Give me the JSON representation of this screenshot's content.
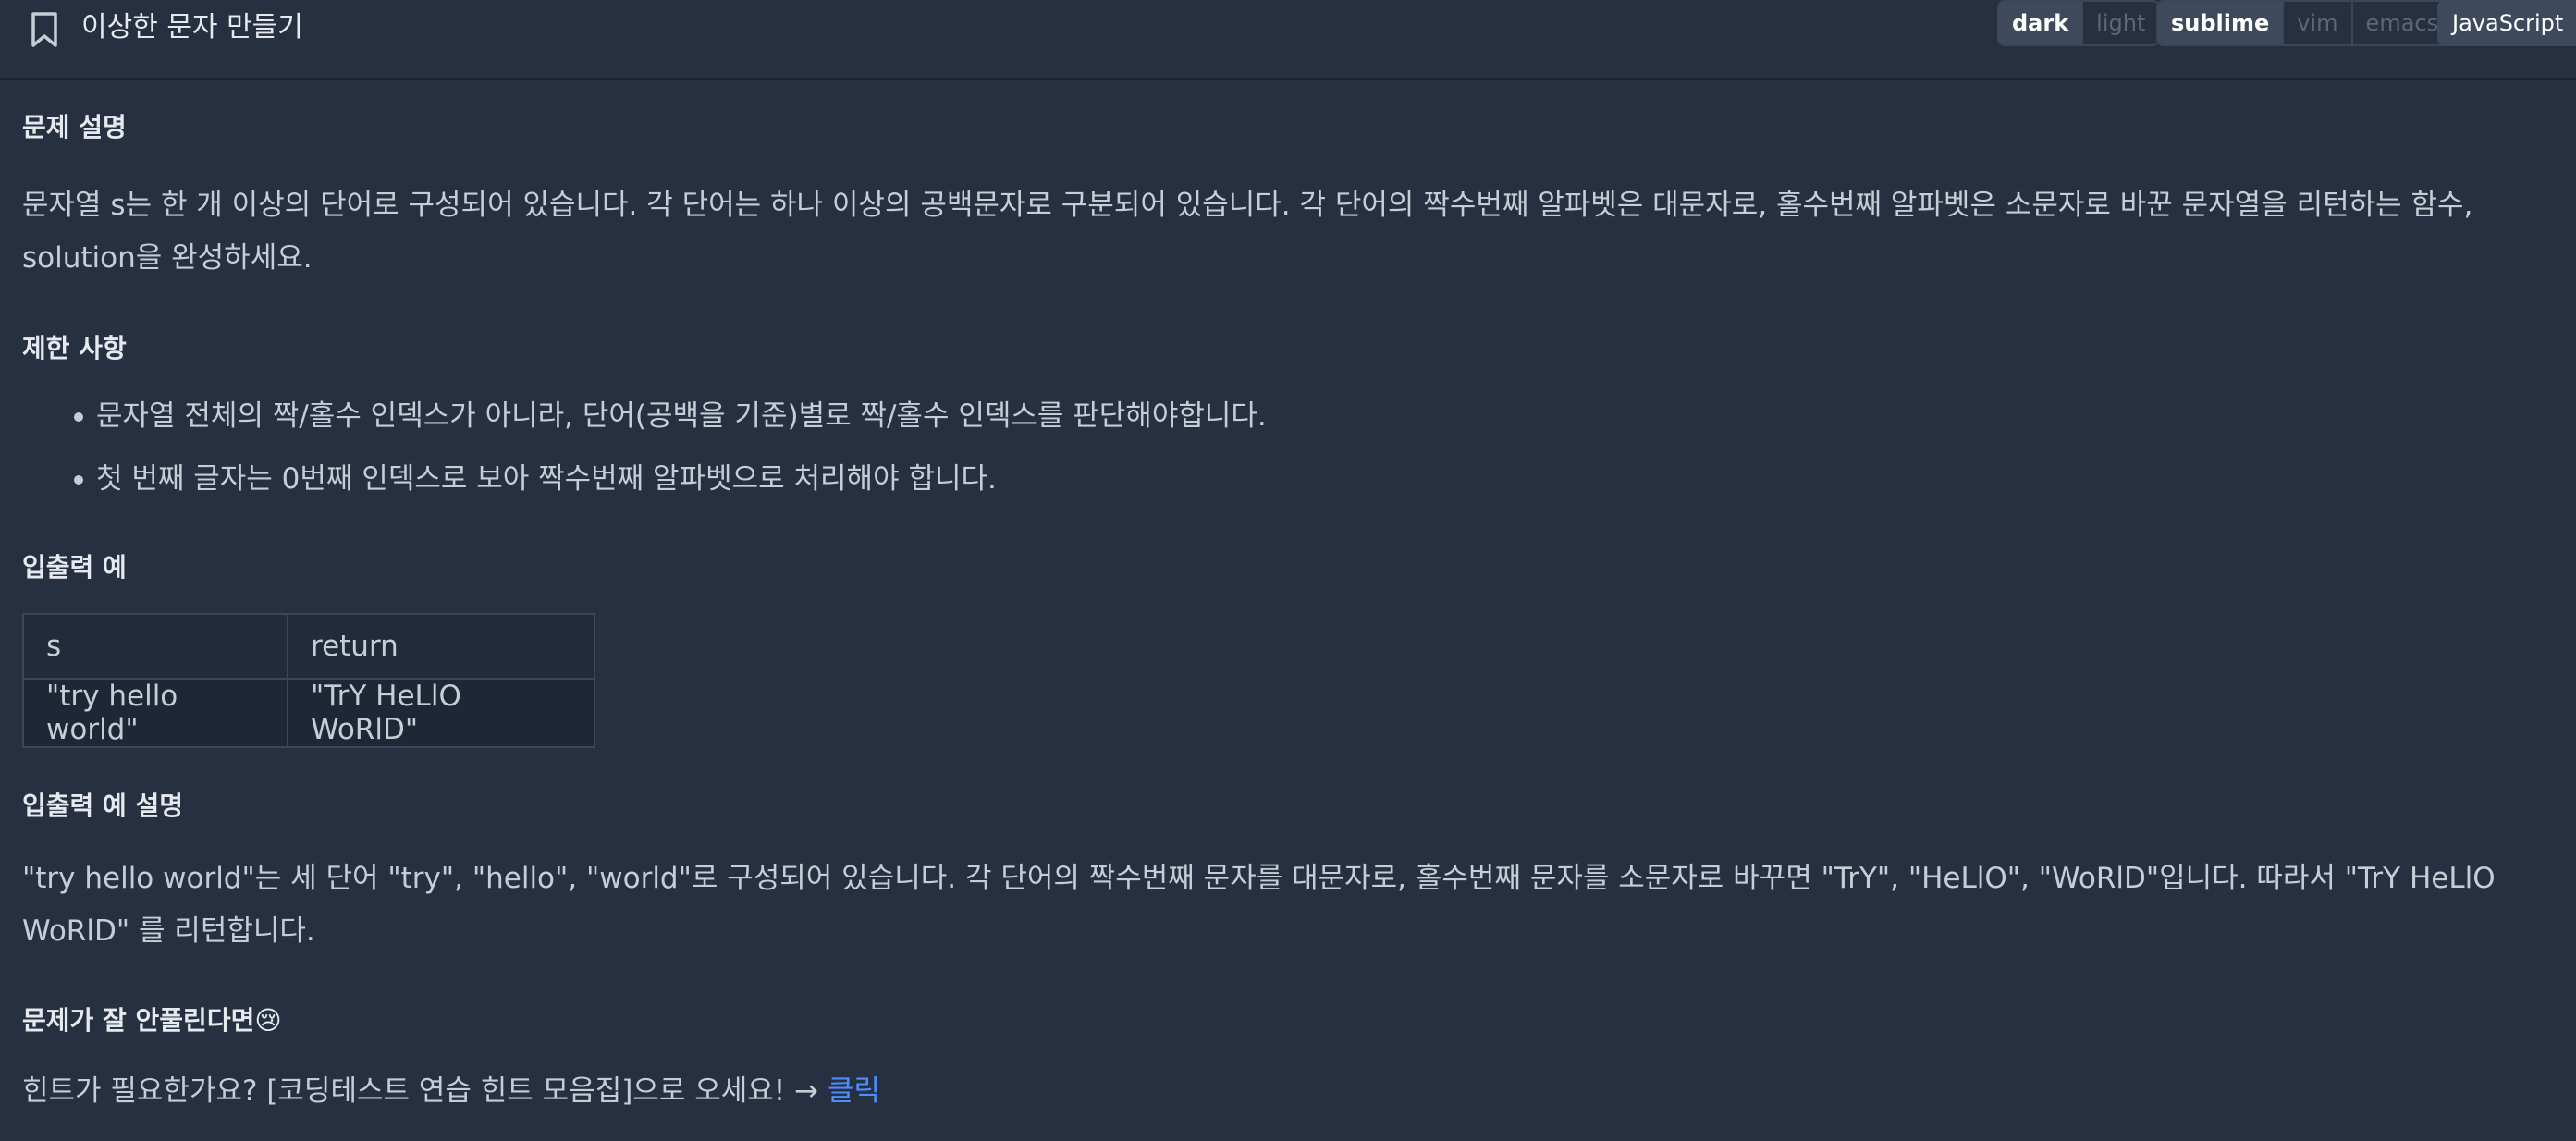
{
  "header": {
    "title": "이상한 문자 만들기",
    "theme_options": [
      {
        "label": "dark",
        "active": true
      },
      {
        "label": "light",
        "active": false
      }
    ],
    "keymap_options": [
      {
        "label": "sublime",
        "active": true
      },
      {
        "label": "vim",
        "active": false
      },
      {
        "label": "emacs",
        "active": false
      }
    ],
    "language": "JavaScript"
  },
  "sections": {
    "description": {
      "heading": "문제 설명",
      "text": "문자열 s는 한 개 이상의 단어로 구성되어 있습니다. 각 단어는 하나 이상의 공백문자로 구분되어 있습니다. 각 단어의 짝수번째 알파벳은 대문자로, 홀수번째 알파벳은 소문자로 바꾼 문자열을 리턴하는 함수, solution을 완성하세요."
    },
    "constraints": {
      "heading": "제한 사항",
      "items": [
        "문자열 전체의 짝/홀수 인덱스가 아니라, 단어(공백을 기준)별로 짝/홀수 인덱스를 판단해야합니다.",
        "첫 번째 글자는 0번째 인덱스로 보아 짝수번째 알파벳으로 처리해야 합니다."
      ]
    },
    "examples": {
      "heading": "입출력 예",
      "columns": [
        "s",
        "return"
      ],
      "rows": [
        [
          "\"try hello world\"",
          "\"TrY HeLlO WoRlD\""
        ]
      ]
    },
    "example_explanation": {
      "heading": "입출력 예 설명",
      "text": "\"try hello world\"는 세 단어 \"try\", \"hello\", \"world\"로 구성되어 있습니다. 각 단어의 짝수번째 문자를 대문자로, 홀수번째 문자를 소문자로 바꾸면 \"TrY\", \"HeLlO\", \"WoRlD\"입니다. 따라서 \"TrY HeLlO WoRlD\" 를 리턴합니다."
    },
    "hint": {
      "heading": "문제가 잘 안풀린다면😢",
      "text": "힌트가 필요한가요? [코딩테스트 연습 힌트 모음집]으로 오세요! → ",
      "link": "클릭"
    }
  },
  "colors": {
    "background": "#263040",
    "accent_link": "#4d8eff",
    "active_button": "#3e4a5b"
  }
}
